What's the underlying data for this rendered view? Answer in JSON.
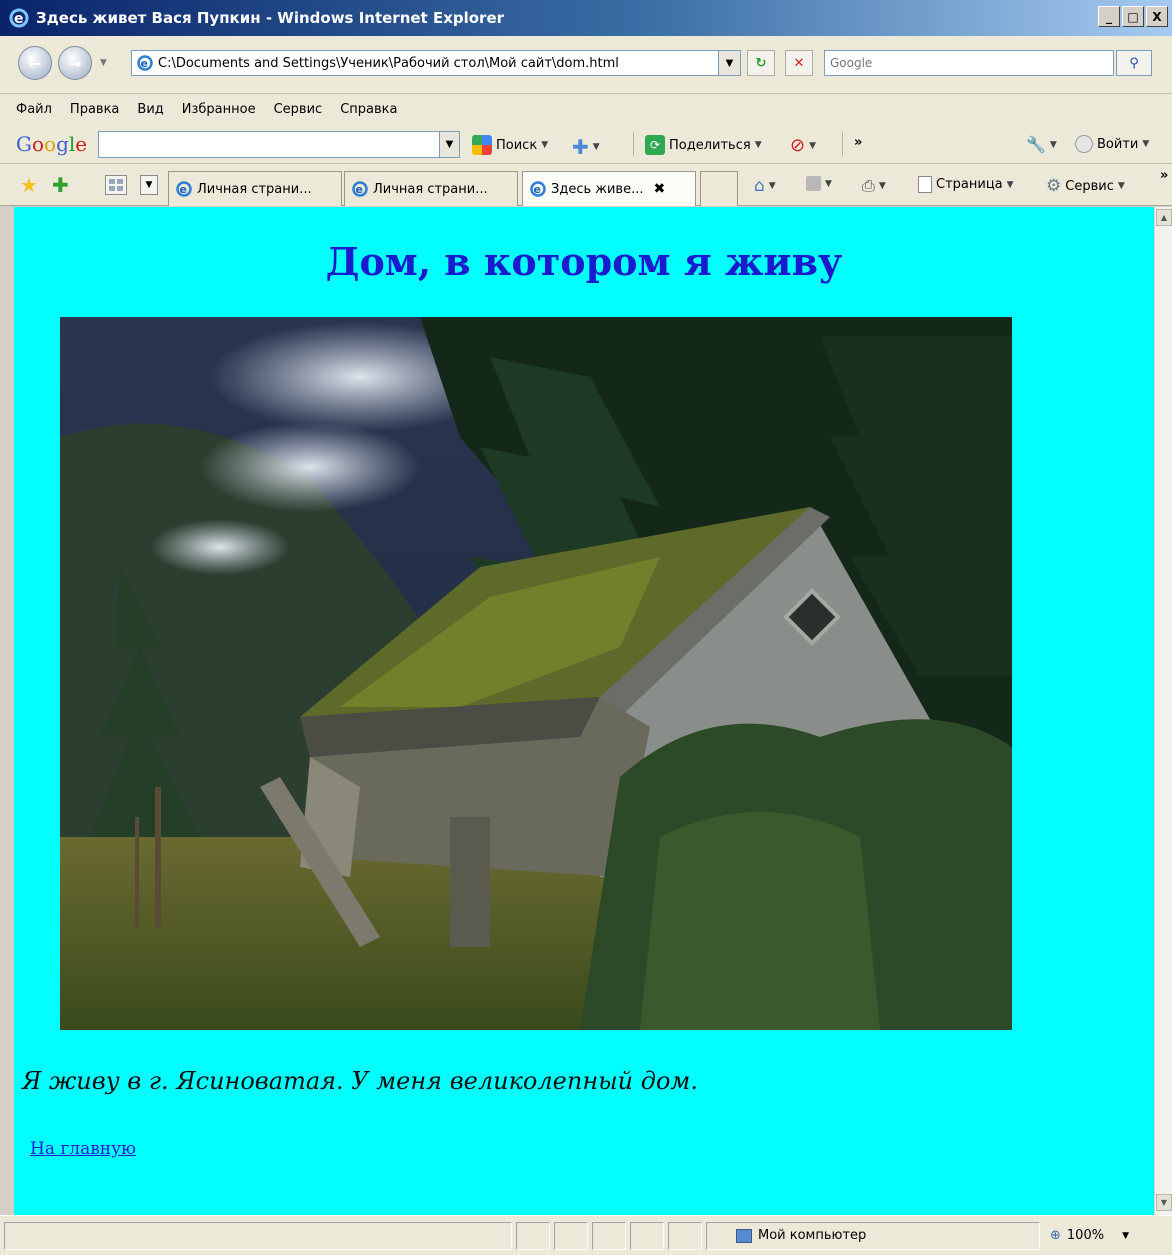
{
  "window": {
    "title": "Здесь живет Вася Пупкин - Windows Internet Explorer",
    "controls": [
      "_",
      "□",
      "X"
    ]
  },
  "navigation": {
    "address": "C:\\Documents and Settings\\Ученик\\Рабочий стол\\Мой сайт\\dom.html",
    "search_placeholder": "Google"
  },
  "menu": [
    "Файл",
    "Правка",
    "Вид",
    "Избранное",
    "Сервис",
    "Справка"
  ],
  "google_toolbar": {
    "logo": "Google",
    "search_label": "Поиск",
    "share_label": "Поделиться",
    "more": "»",
    "signin_label": "Войти"
  },
  "tabs": [
    {
      "label": "Личная страни...",
      "active": false
    },
    {
      "label": "Личная страни...",
      "active": false
    },
    {
      "label": "Здесь живе...",
      "active": true
    }
  ],
  "commandbar": {
    "page_label": "Страница",
    "tools_label": "Сервис",
    "more": "»"
  },
  "page": {
    "heading": "Дом, в котором я живу",
    "intro": "Я живу в г. Ясиноватая. У меня великолепный дом.",
    "home_link": "На главную"
  },
  "status": {
    "zone": "Мой компьютер",
    "zoom": "100%"
  },
  "colors": {
    "page_background": "#00ffff",
    "heading": "#1a1acf",
    "link": "#2020d0",
    "title_bar": "#0a246a",
    "chrome": "#ece9d8"
  }
}
